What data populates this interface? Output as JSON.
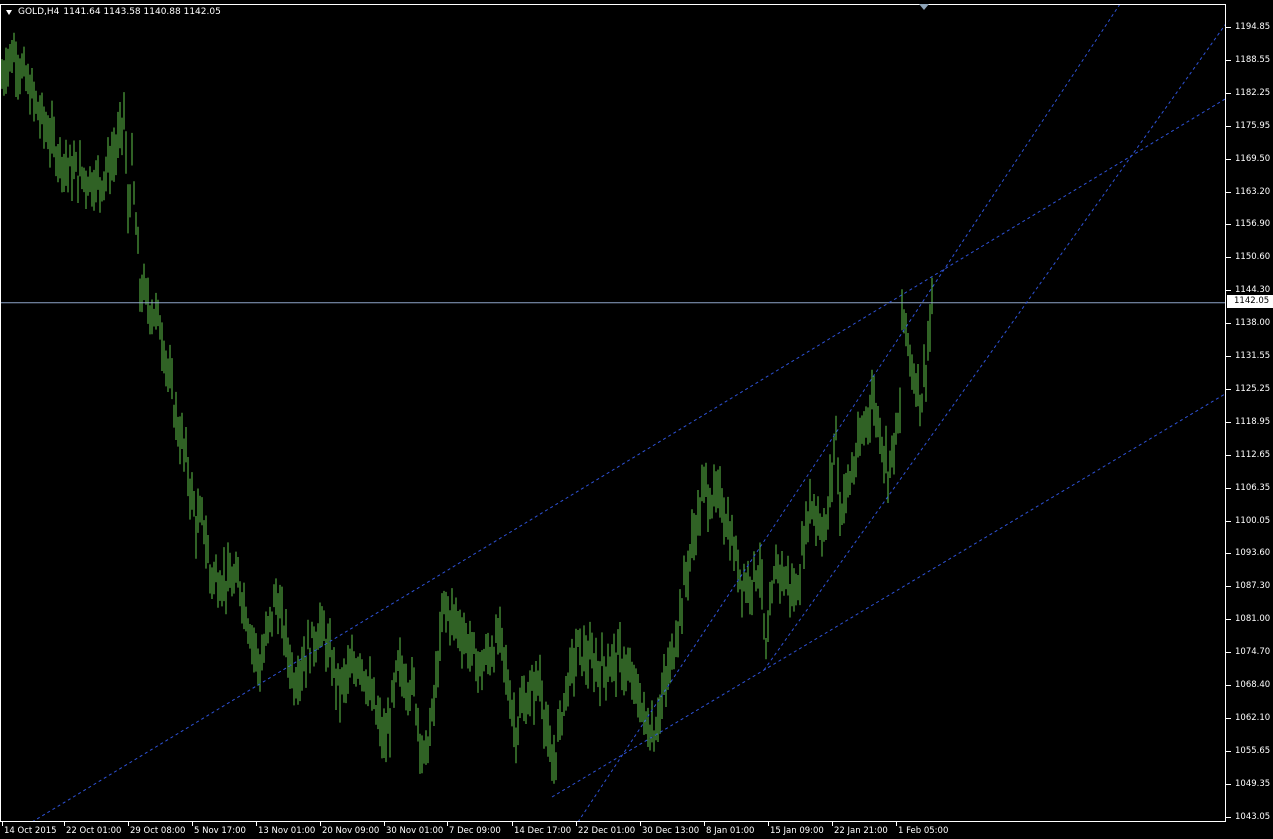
{
  "header": {
    "symbol": "GOLD,H4",
    "ohlc": "1141.64 1143.58 1140.88 1142.05"
  },
  "current_price_label": "1142.05",
  "colors": {
    "background": "#000000",
    "candle": "#5fc34a",
    "trendline": "#2e52d6",
    "bid_line": "#8ea4c8",
    "text": "#ffffff"
  },
  "y_axis_labels": [
    "1194.85",
    "1188.55",
    "1182.25",
    "1175.95",
    "1169.50",
    "1163.20",
    "1156.90",
    "1150.60",
    "1144.30",
    "1138.00",
    "1131.55",
    "1125.25",
    "1118.95",
    "1112.65",
    "1106.35",
    "1100.05",
    "1093.60",
    "1087.30",
    "1081.00",
    "1074.70",
    "1068.40",
    "1062.10",
    "1055.65",
    "1049.35",
    "1043.05"
  ],
  "x_axis_labels": [
    "14 Oct 2015",
    "22 Oct 01:00",
    "29 Oct 08:00",
    "5 Nov 17:00",
    "13 Nov 01:00",
    "20 Nov 09:00",
    "30 Nov 01:00",
    "7 Dec 09:00",
    "14 Dec 17:00",
    "22 Dec 01:00",
    "30 Dec 13:00",
    "8 Jan 01:00",
    "15 Jan 09:00",
    "22 Jan 21:00",
    "1 Feb 05:00"
  ],
  "chart_data": {
    "type": "line",
    "title": "GOLD,H4",
    "x": [
      "14 Oct 2015",
      "22 Oct 01:00",
      "29 Oct 08:00",
      "5 Nov 17:00",
      "13 Nov 01:00",
      "20 Nov 09:00",
      "30 Nov 01:00",
      "7 Dec 09:00",
      "14 Dec 17:00",
      "22 Dec 01:00",
      "30 Dec 13:00",
      "8 Jan 01:00",
      "15 Jan 09:00",
      "22 Jan 21:00",
      "1 Feb 05:00"
    ],
    "series": [
      {
        "values": [
          1188,
          1168,
          1168,
          1100,
          1072,
          1078,
          1060,
          1082,
          1060,
          1075,
          1062,
          1105,
          1085,
          1118,
          1142
        ]
      }
    ],
    "ylim": [
      1043.05,
      1198
    ],
    "current_price": 1142.05,
    "grid": false
  }
}
